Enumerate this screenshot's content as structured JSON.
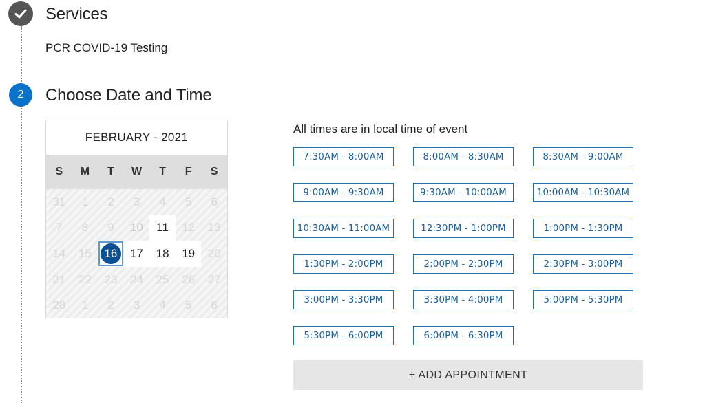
{
  "steps": {
    "services": {
      "title": "Services",
      "value": "PCR COVID-19 Testing"
    },
    "date_time": {
      "number": "2",
      "title": "Choose Date and Time"
    }
  },
  "calendar": {
    "month_label": "FEBRUARY - 2021",
    "weekdays": [
      "S",
      "M",
      "T",
      "W",
      "T",
      "F",
      "S"
    ],
    "weeks": [
      [
        {
          "d": "31",
          "s": "disabled"
        },
        {
          "d": "1",
          "s": "disabled"
        },
        {
          "d": "2",
          "s": "disabled"
        },
        {
          "d": "3",
          "s": "disabled"
        },
        {
          "d": "4",
          "s": "disabled"
        },
        {
          "d": "5",
          "s": "disabled"
        },
        {
          "d": "6",
          "s": "disabled"
        }
      ],
      [
        {
          "d": "7",
          "s": "disabled"
        },
        {
          "d": "8",
          "s": "disabled"
        },
        {
          "d": "9",
          "s": "disabled"
        },
        {
          "d": "10",
          "s": "dim"
        },
        {
          "d": "11",
          "s": "available"
        },
        {
          "d": "12",
          "s": "disabled"
        },
        {
          "d": "13",
          "s": "disabled"
        }
      ],
      [
        {
          "d": "14",
          "s": "disabled"
        },
        {
          "d": "15",
          "s": "disabled"
        },
        {
          "d": "16",
          "s": "selected"
        },
        {
          "d": "17",
          "s": "available"
        },
        {
          "d": "18",
          "s": "available"
        },
        {
          "d": "19",
          "s": "available"
        },
        {
          "d": "20",
          "s": "disabled"
        }
      ],
      [
        {
          "d": "21",
          "s": "disabled"
        },
        {
          "d": "22",
          "s": "disabled"
        },
        {
          "d": "23",
          "s": "disabled"
        },
        {
          "d": "24",
          "s": "disabled"
        },
        {
          "d": "25",
          "s": "disabled"
        },
        {
          "d": "26",
          "s": "disabled"
        },
        {
          "d": "27",
          "s": "disabled"
        }
      ],
      [
        {
          "d": "28",
          "s": "disabled"
        },
        {
          "d": "1",
          "s": "disabled"
        },
        {
          "d": "2",
          "s": "disabled"
        },
        {
          "d": "3",
          "s": "disabled"
        },
        {
          "d": "4",
          "s": "disabled"
        },
        {
          "d": "5",
          "s": "disabled"
        },
        {
          "d": "6",
          "s": "disabled"
        }
      ]
    ]
  },
  "times": {
    "note": "All times are in local time of event",
    "slots": [
      "7:30AM - 8:00AM",
      "8:00AM - 8:30AM",
      "8:30AM - 9:00AM",
      "9:00AM - 9:30AM",
      "9:30AM - 10:00AM",
      "10:00AM - 10:30AM",
      "10:30AM - 11:00AM",
      "12:30PM - 1:00PM",
      "1:00PM - 1:30PM",
      "1:30PM - 2:00PM",
      "2:00PM - 2:30PM",
      "2:30PM - 3:00PM",
      "3:00PM - 3:30PM",
      "3:30PM - 4:00PM",
      "5:00PM - 5:30PM",
      "5:30PM - 6:00PM",
      "6:00PM - 6:30PM"
    ]
  },
  "add_appointment_label": "+ ADD APPOINTMENT",
  "colors": {
    "accent": "#0a72c9",
    "selected_day": "#0b4f96",
    "slot_text": "#1b5e99",
    "done_step": "#555555"
  },
  "icons": {
    "completed_step": "checkmark-icon"
  }
}
